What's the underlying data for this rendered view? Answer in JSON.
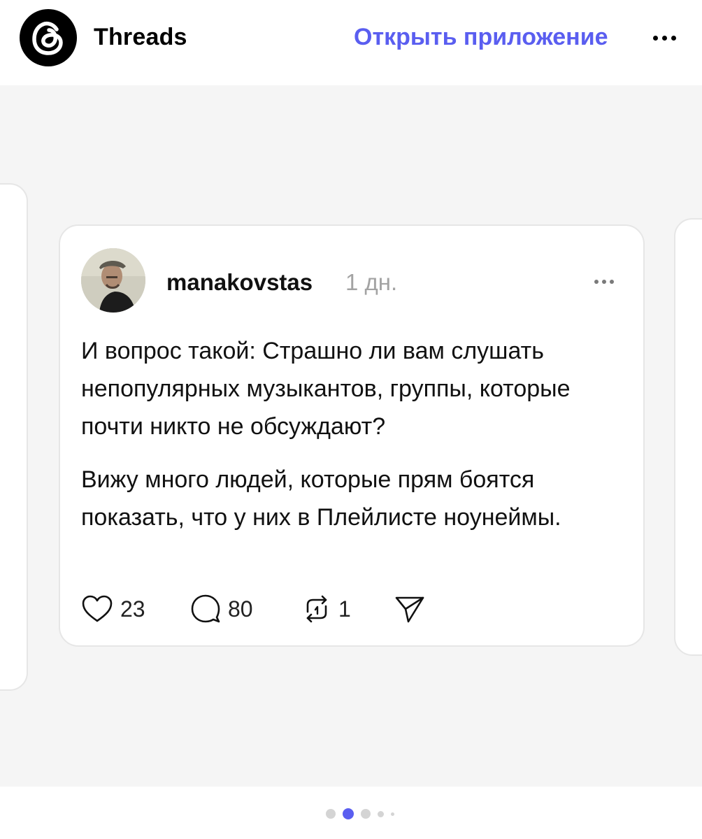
{
  "header": {
    "brand": "Threads",
    "open_app_label": "Открыть приложение",
    "logo_icon": "threads-logo-icon",
    "more_icon": "more-horizontal-icon"
  },
  "post": {
    "username": "manakovstas",
    "time": "1 дн.",
    "paragraphs": [
      "И вопрос такой: Страшно ли вам слушать непопулярных музыкантов, группы, которые почти никто не обсуждают?",
      "Вижу много людей, которые прям боятся показать, что у них в Плейлисте ноунеймы."
    ],
    "actions": {
      "likes": "23",
      "replies": "80",
      "reposts": "1"
    },
    "icons": [
      "heart-icon",
      "comment-icon",
      "repost-icon",
      "share-icon"
    ]
  },
  "pager": {
    "count": 5,
    "active_index": 1
  },
  "colors": {
    "accent": "#5a5ef0",
    "background": "#f5f5f5",
    "card": "#ffffff",
    "muted": "#a3a3a3"
  }
}
